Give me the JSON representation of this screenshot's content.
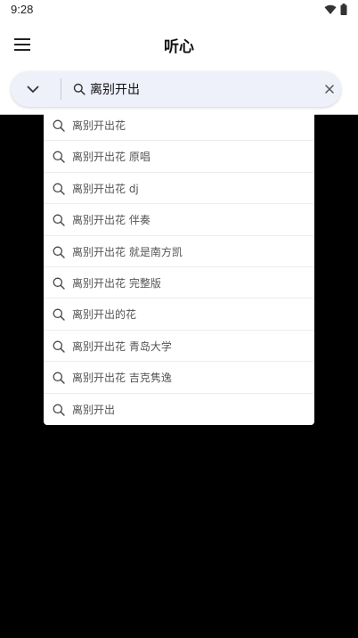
{
  "status_bar": {
    "time": "9:28",
    "icons": [
      "wifi-icon",
      "battery-icon"
    ]
  },
  "app_bar": {
    "title": "听心",
    "menu_icon": "hamburger-menu-icon"
  },
  "search": {
    "query": "离别开出",
    "collapse_icon": "chevron-down-icon",
    "search_icon": "search-icon",
    "clear_icon": "close-icon"
  },
  "suggestions": [
    "离别开出花",
    "离别开出花 原唱",
    "离别开出花 dj",
    "离别开出花 伴奏",
    "离别开出花 就是南方凯",
    "离别开出花 完整版",
    "离别开出的花",
    "离别开出花 青岛大学",
    "离别开出花 吉克隽逸",
    "离别开出"
  ],
  "colors": {
    "background": "#000000",
    "surface": "#ffffff",
    "search_pill": "#eef0fa"
  }
}
